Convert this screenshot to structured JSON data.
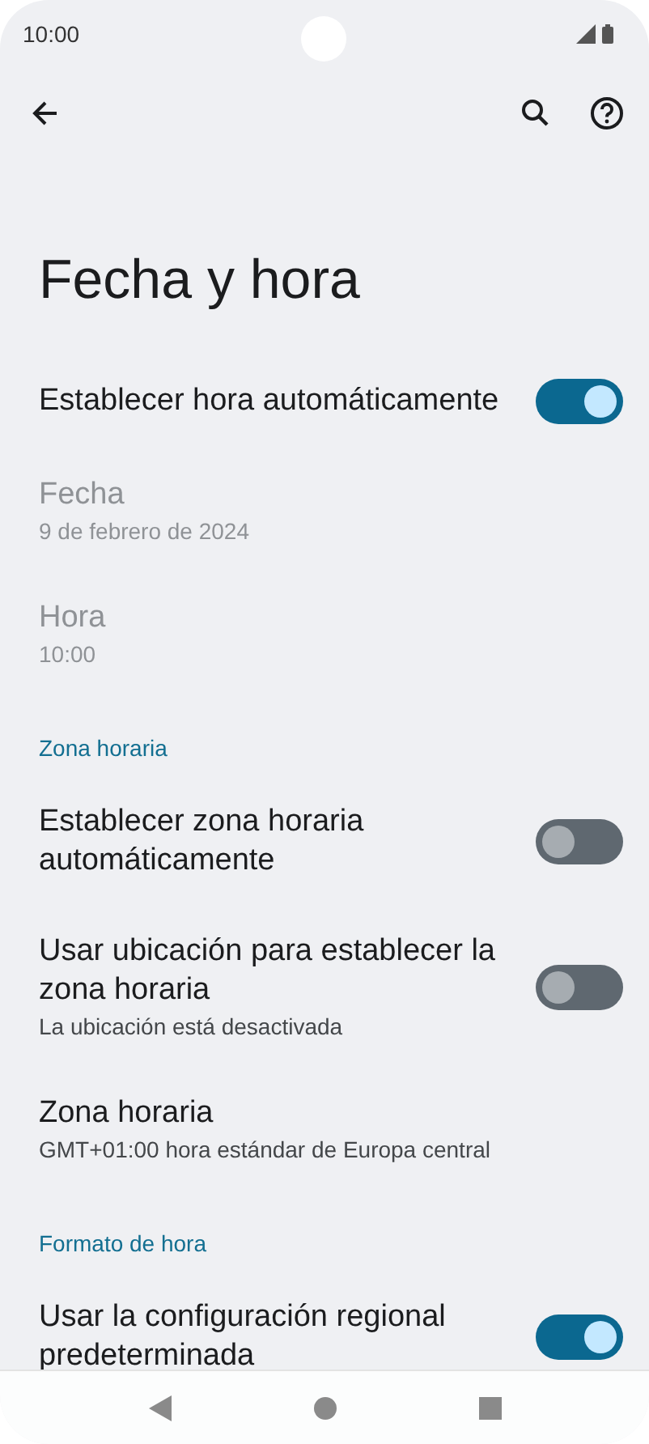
{
  "status_bar": {
    "time": "10:00"
  },
  "title": "Fecha y hora",
  "items": [
    {
      "kind": "switch",
      "title": "Establecer hora automáticamente",
      "on": true,
      "disabled": false
    },
    {
      "kind": "value",
      "title": "Fecha",
      "summary": "9 de febrero de 2024",
      "disabled": true
    },
    {
      "kind": "value",
      "title": "Hora",
      "summary": "10:00",
      "disabled": true
    },
    {
      "kind": "header",
      "title": "Zona horaria"
    },
    {
      "kind": "switch",
      "title": "Establecer zona horaria automáticamente",
      "on": false,
      "disabled": false
    },
    {
      "kind": "switch",
      "title": "Usar ubicación para establecer la zona horaria",
      "summary": "La ubicación está desactivada",
      "on": false,
      "disabled": false
    },
    {
      "kind": "value",
      "title": "Zona horaria",
      "summary": "GMT+01:00 hora estándar de Europa central",
      "disabled": false
    },
    {
      "kind": "header",
      "title": "Formato de hora"
    },
    {
      "kind": "switch",
      "title": "Usar la configuración regional predeterminada",
      "on": true,
      "disabled": false
    }
  ]
}
